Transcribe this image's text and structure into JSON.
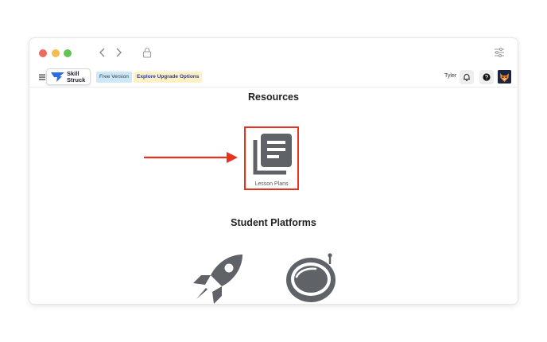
{
  "app": {
    "logo_text_line1": "Skill",
    "logo_text_line2": "Struck",
    "free_badge": "Free Version",
    "upgrade_badge": "Explore Upgrade Options",
    "user_name": "Tyler"
  },
  "resources": {
    "title": "Resources",
    "items": [
      {
        "label": "Lesson Plans",
        "icon": "lesson-plans-icon"
      }
    ]
  },
  "student_platforms": {
    "title": "Student Platforms",
    "items": [
      {
        "icon": "rocket-icon"
      },
      {
        "icon": "astronaut-helmet-icon"
      }
    ]
  },
  "colors": {
    "highlight": "#e8321c",
    "icon_gray": "#5f6368",
    "brand_blue": "#2c6be0",
    "free_badge_bg": "#cfe8f7",
    "upgrade_badge_bg": "#fdf1c8"
  }
}
